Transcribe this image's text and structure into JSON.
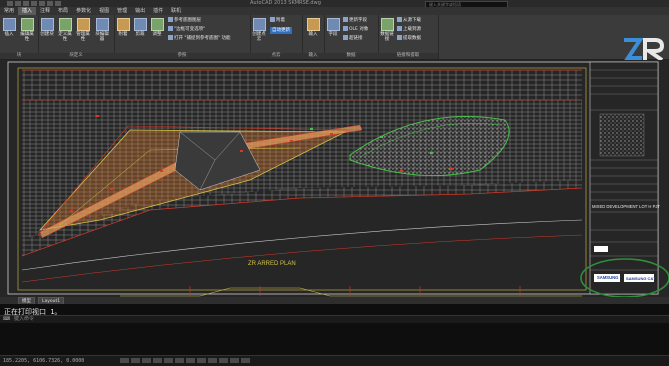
{
  "app": {
    "title": "AutoCAD 2013   SKMRSE.dwg",
    "search_placeholder": "键入关键字或短语"
  },
  "tabs": [
    "常用",
    "插入",
    "注释",
    "布局",
    "参数化",
    "视图",
    "管理",
    "输出",
    "插件",
    "联机"
  ],
  "active_tab": "插入",
  "ribbon": {
    "panels": [
      {
        "title": "块",
        "buttons": [
          "插入",
          "编辑属性"
        ]
      },
      {
        "title": "块定义",
        "buttons": [
          "创建块",
          "定义属性",
          "管理属性",
          "块编辑器"
        ]
      },
      {
        "title": "参照",
        "buttons": [
          "附着",
          "剪裁",
          "调整"
        ],
        "small": [
          "参考底图图层",
          "\"边框可变选项\"",
          "打开 \"捕捉到参考底图\" 功能"
        ]
      },
      {
        "title": "点云",
        "buttons": [
          "创建点云",
          "附着"
        ],
        "small": [
          "自动更新"
        ]
      },
      {
        "title": "输入",
        "buttons": [
          "输入"
        ]
      },
      {
        "title": "数据",
        "buttons": [
          "字段"
        ],
        "small": [
          "更新字段",
          "OLE 对象",
          "超链接"
        ]
      },
      {
        "title": "链接和提取",
        "buttons": [
          "数据链接"
        ],
        "small": [
          "从源下载",
          "上载到源",
          "提取数据"
        ]
      }
    ]
  },
  "drawing": {
    "title_block": {
      "project": "MIXED DEVELOPMENT LOT H PJT",
      "client1": "SAMSUNG",
      "client2": "SAMSUNG C&T"
    },
    "viewport_label": "ZR ARRED PLAN"
  },
  "file_tabs": [
    "模型",
    "Layout1"
  ],
  "command": {
    "history": "正在打印视口 1。",
    "placeholder": "键入命令"
  },
  "status": {
    "coordinates": "185.2205, 6106.7326, 0.0000"
  },
  "colors": {
    "paving_yellow": "#d4c24a",
    "boundary_red": "#d23a2a",
    "planter_green": "#48c04a",
    "accent_orange": "#e07a2a",
    "callout_green": "#2f8f3a"
  },
  "icons": [
    "autocad-app-icon",
    "zr-logo",
    "samsung-logo"
  ]
}
